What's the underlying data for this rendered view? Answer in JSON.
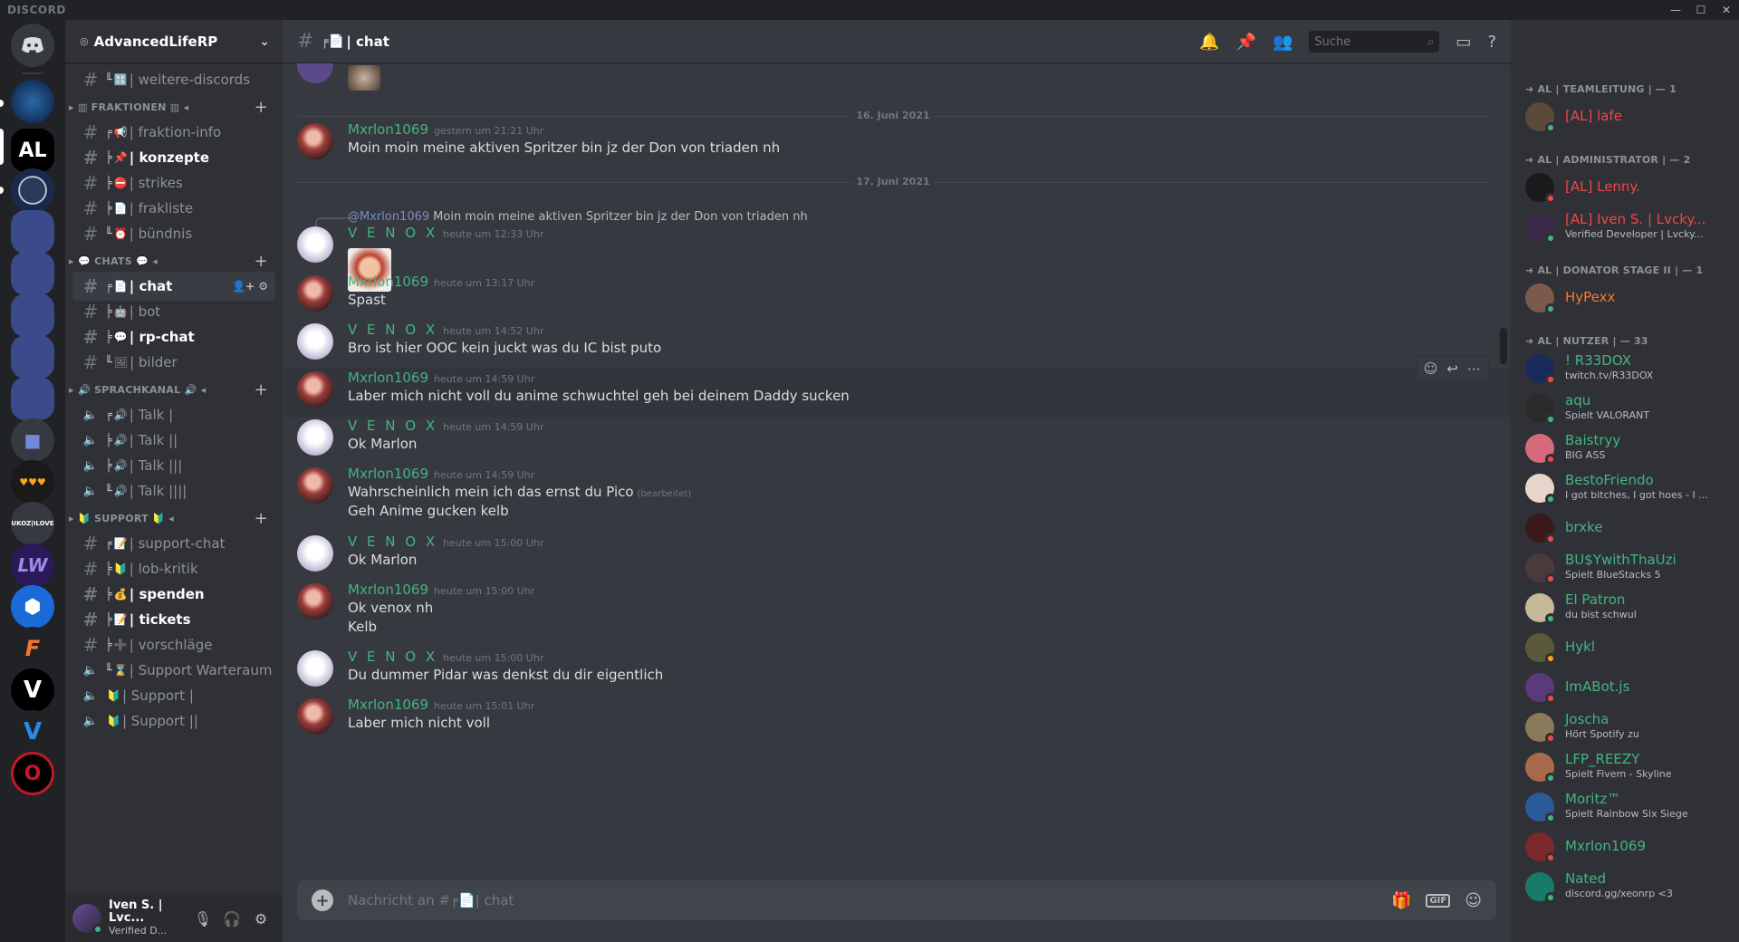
{
  "app": {
    "brand": "DISCORD",
    "win_min": "—",
    "win_max": "☐",
    "win_close": "✕"
  },
  "server": {
    "name": "AdvancedLifeRP"
  },
  "channels_list": [
    {
      "kind": "text",
      "tree": "╙",
      "emoji": "🔠",
      "name": "| weitere-discords",
      "bold": false
    },
    {
      "kind": "category",
      "name": "▸ ▥ FRAKTIONEN ▥ ◂"
    },
    {
      "kind": "text",
      "tree": "╒",
      "emoji": "📢",
      "name": "| fraktion-info",
      "bold": false
    },
    {
      "kind": "text",
      "tree": "╞",
      "emoji": "📌",
      "name": "| konzepte",
      "bold": true
    },
    {
      "kind": "text",
      "tree": "╞",
      "emoji": "⛔",
      "name": "| strikes",
      "bold": false
    },
    {
      "kind": "text",
      "tree": "╞",
      "emoji": "📄",
      "name": "| frakliste",
      "bold": false
    },
    {
      "kind": "text",
      "tree": "╙",
      "emoji": "⏰",
      "name": "| bündnis",
      "bold": false
    },
    {
      "kind": "category",
      "name": "▸ 💬 CHATS 💬 ◂"
    },
    {
      "kind": "text",
      "tree": "╒",
      "emoji": "📄",
      "name": "| chat",
      "bold": true,
      "active": true
    },
    {
      "kind": "text",
      "tree": "╞",
      "emoji": "🤖",
      "name": "| bot",
      "bold": false
    },
    {
      "kind": "text",
      "tree": "╞",
      "emoji": "💬",
      "name": "| rp-chat",
      "bold": true
    },
    {
      "kind": "text",
      "tree": "╙",
      "emoji": "🖼",
      "name": "| bilder",
      "bold": false
    },
    {
      "kind": "category",
      "name": "▸ 🔊 SPRACHKANAL 🔊 ◂"
    },
    {
      "kind": "voice",
      "tree": "╒",
      "emoji": "🔊",
      "name": "| Talk |",
      "bold": false
    },
    {
      "kind": "voice",
      "tree": "╞",
      "emoji": "🔊",
      "name": "| Talk ||",
      "bold": false
    },
    {
      "kind": "voice",
      "tree": "╞",
      "emoji": "🔊",
      "name": "| Talk |||",
      "bold": false
    },
    {
      "kind": "voice",
      "tree": "╙",
      "emoji": "🔊",
      "name": "| Talk ||||",
      "bold": false
    },
    {
      "kind": "category",
      "name": "▸ 🔰 SUPPORT 🔰 ◂"
    },
    {
      "kind": "text",
      "tree": "╒",
      "emoji": "📝",
      "name": "| support-chat",
      "bold": false
    },
    {
      "kind": "text",
      "tree": "╞",
      "emoji": "🔰",
      "name": "| lob-kritik",
      "bold": false
    },
    {
      "kind": "text",
      "tree": "╞",
      "emoji": "💰",
      "name": "| spenden",
      "bold": true
    },
    {
      "kind": "text",
      "tree": "╞",
      "emoji": "📝",
      "name": "| tickets",
      "bold": true
    },
    {
      "kind": "text",
      "tree": "╞",
      "emoji": "➕",
      "name": "| vorschläge",
      "bold": false
    },
    {
      "kind": "voice",
      "tree": "╙",
      "emoji": "⌛",
      "name": "| Support Warteraum",
      "bold": false
    },
    {
      "kind": "voice",
      "tree": "",
      "emoji": "🔰",
      "name": "| Support |",
      "bold": false
    },
    {
      "kind": "voice",
      "tree": "",
      "emoji": "🔰",
      "name": "| Support ||",
      "bold": false
    }
  ],
  "user_panel": {
    "name": "Iven S. | Lvc...",
    "status": "Verified D..."
  },
  "header": {
    "channel": "| chat",
    "channel_prefix": "╒📄",
    "search_placeholder": "Suche"
  },
  "dividers": [
    "16. Juni 2021",
    "17. Juni 2021"
  ],
  "messages": [
    {
      "author": "Mxrlon1069",
      "who": "mx",
      "time": "gestern um 21:21 Uhr",
      "lines": [
        "Moin moin meine aktiven Spritzer bin jz der Don von triaden nh"
      ]
    },
    {
      "author": "V E N O X",
      "who": "ve",
      "time": "heute um 12:33 Uhr",
      "reply_to": "@Mxrlon1069",
      "reply_text": "Moin moin meine aktiven Spritzer bin jz der Don von triaden nh",
      "lines": []
    },
    {
      "author": "Mxrlon1069",
      "who": "mx",
      "time": "heute um 13:17 Uhr",
      "lines": [
        "Spast"
      ]
    },
    {
      "author": "V E N O X",
      "who": "ve",
      "time": "heute um 14:52 Uhr",
      "lines": [
        "Bro ist hier OOC kein juckt was du IC bist puto"
      ]
    },
    {
      "author": "Mxrlon1069",
      "who": "mx",
      "time": "heute um 14:59 Uhr",
      "lines": [
        "Laber mich nicht voll du anime schwuchtel geh bei deinem Daddy sucken"
      ]
    },
    {
      "author": "V E N O X",
      "who": "ve",
      "time": "heute um 14:59 Uhr",
      "lines": [
        "Ok Marlon"
      ]
    },
    {
      "author": "Mxrlon1069",
      "who": "mx",
      "time": "heute um 14:59 Uhr",
      "lines": [
        "Wahrscheinlich mein ich das ernst du Pico",
        "Geh Anime gucken kelb"
      ],
      "edited": "(bearbeitet)"
    },
    {
      "author": "V E N O X",
      "who": "ve",
      "time": "heute um 15:00 Uhr",
      "lines": [
        "Ok Marlon"
      ]
    },
    {
      "author": "Mxrlon1069",
      "who": "mx",
      "time": "heute um 15:00 Uhr",
      "lines": [
        "Ok venox nh",
        "Kelb"
      ]
    },
    {
      "author": "V E N O X",
      "who": "ve",
      "time": "heute um 15:00 Uhr",
      "lines": [
        "Du dummer Pidar was denkst du dir eigentlich"
      ]
    },
    {
      "author": "Mxrlon1069",
      "who": "mx",
      "time": "heute um 15:01 Uhr",
      "lines": [
        "Laber mich nicht voll"
      ]
    }
  ],
  "composer": {
    "placeholder": "Nachricht an #╒📄| chat",
    "gif": "GIF"
  },
  "members": {
    "roles": [
      {
        "title": "➜ AL | TEAMLEITUNG | — 1"
      },
      {
        "title": "➜ AL | ADMINISTRATOR | — 2"
      },
      {
        "title": "➜ AL | DONATOR STAGE II | — 1"
      },
      {
        "title": "➜ AL | NUTZER | — 33"
      }
    ],
    "list": [
      {
        "name": "[AL] lafe",
        "status": "",
        "color": "#f04747",
        "st": "on",
        "av": "#5a4a3a"
      },
      {
        "name": "[AL] Lenny.",
        "status": "",
        "color": "#f04747",
        "st": "dnd",
        "av": "#1a1a1a"
      },
      {
        "name": "[AL] Iven S. | Lvcky...",
        "status": "Verified Developer | Lvcky...",
        "color": "#f04747",
        "st": "on",
        "av": "#3a2a4a"
      },
      {
        "name": "HyPexx",
        "status": "",
        "color": "#f57731",
        "st": "on",
        "av": "#7a5a4a"
      },
      {
        "name": "! R33DOX",
        "status": "twitch.tv/R33DOX",
        "color": "#43b581",
        "st": "dnd",
        "av": "#1a2a5a"
      },
      {
        "name": "aqu",
        "status": "Spielt VALORANT",
        "color": "#43b581",
        "st": "on",
        "av": "#2a2a2a"
      },
      {
        "name": "Baistryy",
        "status": "BIG ASS",
        "color": "#43b581",
        "st": "dnd",
        "av": "#d46a7a"
      },
      {
        "name": "BestoFriendo",
        "status": "I got bitches, I got hoes - I ...",
        "color": "#43b581",
        "st": "on",
        "av": "#e8d4c8"
      },
      {
        "name": "brxke",
        "status": "",
        "color": "#43b581",
        "st": "dnd",
        "av": "#3a1a1a"
      },
      {
        "name": "BU$YwithThaUzi",
        "status": "Spielt BlueStacks 5",
        "color": "#43b581",
        "st": "dnd",
        "av": "#4a3a3a"
      },
      {
        "name": "El Patron",
        "status": "du bist schwul",
        "color": "#43b581",
        "st": "on",
        "av": "#c8b89a"
      },
      {
        "name": "Hykl",
        "status": "",
        "color": "#43b581",
        "st": "idle",
        "av": "#5a5a3a"
      },
      {
        "name": "ImABot.js",
        "status": "",
        "color": "#43b581",
        "st": "dnd",
        "av": "#5a3a7a"
      },
      {
        "name": "Joscha",
        "status": "Hört Spotify zu",
        "color": "#43b581",
        "st": "dnd",
        "av": "#8a7a5a"
      },
      {
        "name": "LFP_REEZY",
        "status": "Spielt Fivem - Skyline",
        "color": "#43b581",
        "st": "on",
        "av": "#a86a4a"
      },
      {
        "name": "Moritz™",
        "status": "Spielt Rainbow Six Siege",
        "color": "#43b581",
        "st": "on",
        "av": "#2a5a9a"
      },
      {
        "name": "Mxrlon1069",
        "status": "",
        "color": "#43b581",
        "st": "dnd",
        "av": "#7a2a2a"
      },
      {
        "name": "Nated",
        "status": "discord.gg/xeonrp <3",
        "color": "#43b581",
        "st": "on",
        "av": "#1a7a6a"
      }
    ]
  }
}
